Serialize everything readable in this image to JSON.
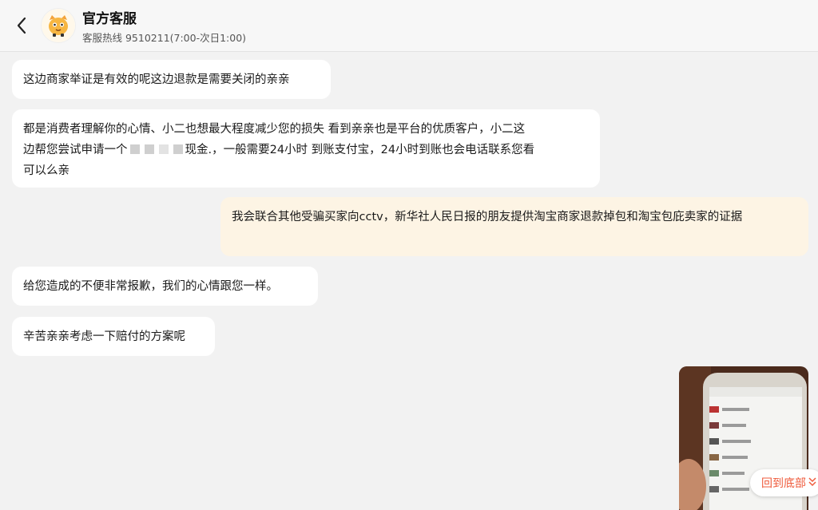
{
  "header": {
    "title": "官方客服",
    "subtitle": "客服热线 9510211(7:00-次日1:00)"
  },
  "messages": [
    {
      "text": "这边商家举证是有效的呢这边退款是需要关闭的亲亲"
    },
    {
      "line1": "都是消费者理解你的心情、小二也想最大程度减少您的损失 看到亲亲也是平台的优质客户，小二这",
      "line2_a": "边帮您尝试申请一个",
      "line2_b": "现金.，一般需要24小时 到账支付宝，24小时到账也会电话联系您看",
      "line3": "可以么亲"
    },
    {
      "text": "我会联合其他受骗买家向cctv，新华社人民日报的朋友提供淘宝商家退款掉包和淘宝包庇卖家的证据"
    },
    {
      "text": "给您造成的不便非常报歉，我们的心情跟您一样。"
    },
    {
      "text": "辛苦亲亲考虑一下赔付的方案呢"
    }
  ],
  "back_to_bottom": "回到底部",
  "colors": {
    "header_bg": "#f7f7f7",
    "chat_bg": "#f2f2f2",
    "incoming_bubble": "#ffffff",
    "outgoing_bubble": "#fdf4e4",
    "accent": "#ef5b3c"
  },
  "icons": {
    "back": "chevron-left-icon",
    "avatar": "mascot-avatar",
    "back_bottom": "double-chevron-down-icon"
  }
}
